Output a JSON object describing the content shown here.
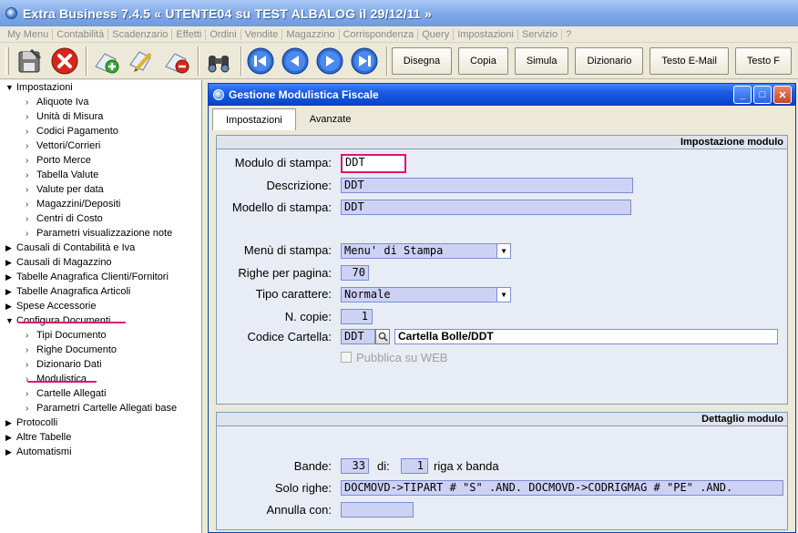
{
  "app": {
    "title": "Extra Business 7.4.5  « UTENTE04 su TEST ALBALOG il 29/12/11 »"
  },
  "menu": [
    "My Menu",
    "Contabilità",
    "Scadenzario",
    "Effetti",
    "Ordini",
    "Vendite",
    "Magazzino",
    "Corrispondenza",
    "Query",
    "Impostazioni",
    "Servizio",
    "?"
  ],
  "toolbar": {
    "icons": [
      "save-icon",
      "cancel-icon",
      "new-icon",
      "edit-icon",
      "delete-icon",
      "search-binoculars-icon"
    ],
    "nav": [
      "first-record-icon",
      "previous-record-icon",
      "next-record-icon",
      "last-record-icon"
    ],
    "buttons": [
      "Disegna",
      "Copia",
      "Simula",
      "Dizionario",
      "Testo E-Mail",
      "Testo F"
    ]
  },
  "tree": {
    "items": [
      {
        "label": "Impostazioni",
        "level": 0,
        "expanded": true
      },
      {
        "label": "Aliquote Iva",
        "level": 1
      },
      {
        "label": "Unità di Misura",
        "level": 1
      },
      {
        "label": "Codici Pagamento",
        "level": 1
      },
      {
        "label": "Vettori/Corrieri",
        "level": 1
      },
      {
        "label": "Porto Merce",
        "level": 1
      },
      {
        "label": "Tabella Valute",
        "level": 1
      },
      {
        "label": "Valute per data",
        "level": 1
      },
      {
        "label": "Magazzini/Depositi",
        "level": 1
      },
      {
        "label": "Centri di Costo",
        "level": 1
      },
      {
        "label": "Parametri visualizzazione note",
        "level": 1
      },
      {
        "label": "Causali di Contabilità e Iva",
        "level": 0,
        "expanded": false
      },
      {
        "label": "Causali di Magazzino",
        "level": 0,
        "expanded": false
      },
      {
        "label": "Tabelle Anagrafica Clienti/Fornitori",
        "level": 0,
        "expanded": false
      },
      {
        "label": "Tabelle Anagrafica Articoli",
        "level": 0,
        "expanded": false
      },
      {
        "label": "Spese Accessorie",
        "level": 0,
        "expanded": false
      },
      {
        "label": "Configura Documenti",
        "level": 0,
        "expanded": true
      },
      {
        "label": "Tipi Documento",
        "level": 1
      },
      {
        "label": "Righe Documento",
        "level": 1
      },
      {
        "label": "Dizionario Dati",
        "level": 1
      },
      {
        "label": "Modulistica",
        "level": 1
      },
      {
        "label": "Cartelle Allegati",
        "level": 1
      },
      {
        "label": "Parametri Cartelle Allegati base",
        "level": 1
      },
      {
        "label": "Protocolli",
        "level": 0,
        "expanded": false
      },
      {
        "label": "Altre Tabelle",
        "level": 0,
        "expanded": false
      },
      {
        "label": "Automatismi",
        "level": 0,
        "expanded": false
      }
    ]
  },
  "window": {
    "title": "Gestione Modulistica Fiscale",
    "tabs": [
      "Impostazioni",
      "Avanzate"
    ],
    "section1": {
      "header": "Impostazione modulo",
      "modulo_label": "Modulo di stampa:",
      "modulo_value": "DDT",
      "descrizione_label": "Descrizione:",
      "descrizione_value": "DDT",
      "modello_label": "Modello di stampa:",
      "modello_value": "DDT",
      "menu_label": "Menù di stampa:",
      "menu_value": "Menu' di Stampa",
      "righe_label": "Righe per pagina:",
      "righe_value": "70",
      "carattere_label": "Tipo carattere:",
      "carattere_value": "Normale",
      "copie_label": "N. copie:",
      "copie_value": "1",
      "cartella_label": "Codice Cartella:",
      "cartella_code": "DDT",
      "cartella_desc": "Cartella Bolle/DDT",
      "web_label": "Pubblica su WEB"
    },
    "section2": {
      "header": "Dettaglio modulo",
      "bande_label": "Bande:",
      "bande_value": "33",
      "di_label": "di:",
      "di_value": "1",
      "riga_label": "riga x banda",
      "solo_label": "Solo righe:",
      "solo_value": "DOCMOVD->TIPART # \"S\" .AND. DOCMOVD->CODRIGMAG # \"PE\" .AND.",
      "annulla_label": "Annulla con:",
      "annulla_value": ""
    }
  },
  "colors": {
    "highlight": "#e0136e",
    "field_bg": "#cdd2f5"
  }
}
